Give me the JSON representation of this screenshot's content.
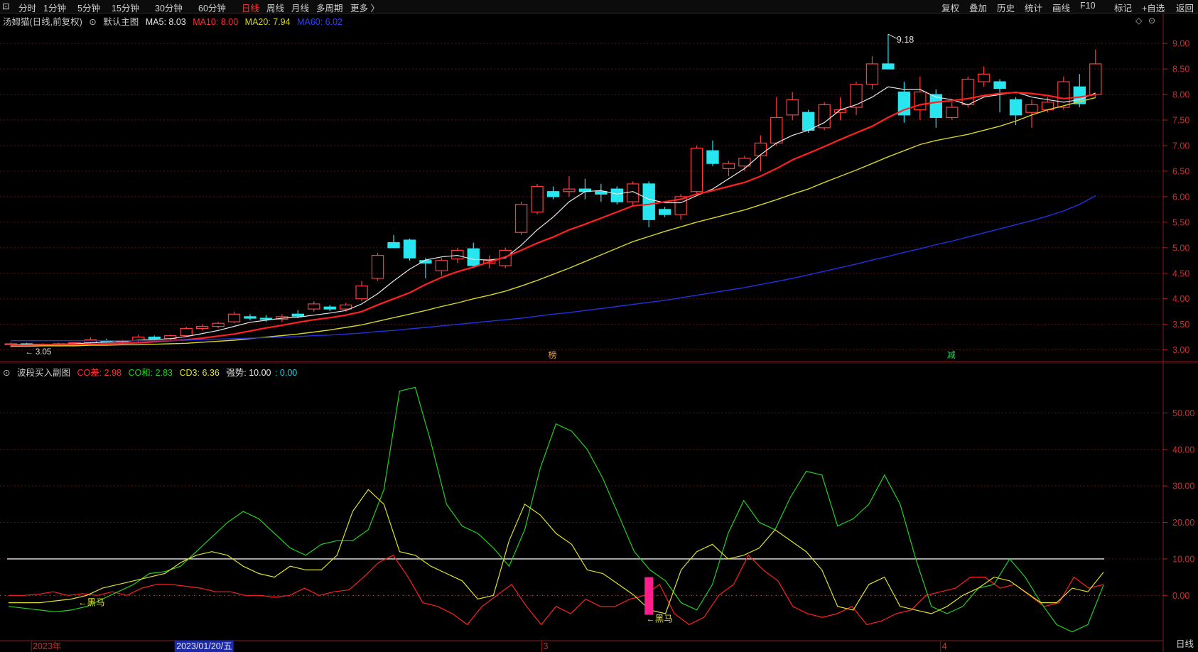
{
  "toolbar": {
    "left": [
      {
        "label": "分时",
        "active": false
      },
      {
        "label": "1分钟",
        "active": false
      },
      {
        "label": "5分钟",
        "active": false
      },
      {
        "label": "15分钟",
        "active": false
      },
      {
        "label": "30分钟",
        "active": false
      },
      {
        "label": "60分钟",
        "active": false
      },
      {
        "label": "日线",
        "active": true
      },
      {
        "label": "周线",
        "active": false
      },
      {
        "label": "月线",
        "active": false
      },
      {
        "label": "多周期",
        "active": false
      },
      {
        "label": "更多 〉",
        "active": false
      }
    ],
    "right": [
      "复权",
      "叠加",
      "历史",
      "统计",
      "画线",
      "F10",
      "标记",
      "+自选",
      "返回"
    ]
  },
  "main_legend": {
    "stock": "汤姆猫(日线,前复权)",
    "template": "默认主图",
    "ma5": "MA5: 8.03",
    "ma10": "MA10: 8.00",
    "ma20": "MA20: 7.94",
    "ma60": "MA60: 6.02"
  },
  "sub_legend": {
    "title": "波段买入副图",
    "co_diff": "CO差: 2.98",
    "co_sum": "CO和: 2.83",
    "cd3": "CD3: 6.36",
    "strength": "强势: 10.00",
    "strength2": ": 0.00"
  },
  "colors": {
    "up": "#ff3b3b",
    "down": "#28e6f0",
    "ma5": "#e8e8e8",
    "ma10": "#ff2020",
    "ma20": "#d6d624",
    "ma60": "#2430e0",
    "co_diff": "#ff2020",
    "co_sum": "#22d022",
    "cd3": "#e0e030",
    "signal": "#ff1e8c"
  },
  "annotations": {
    "high_label": "9.18",
    "low_label": "3.05",
    "mark1": "榜",
    "mark2": "减",
    "heima1": "黑马",
    "heima2": "黑马"
  },
  "x_axis": {
    "labels": [
      {
        "text": "2023年",
        "idx": 2
      },
      {
        "text": "2023/01/20/五",
        "idx": 11
      },
      {
        "text": "3",
        "idx": 34
      },
      {
        "text": "4",
        "idx": 59
      }
    ]
  },
  "bottom_tab": "日线",
  "chart_data": [
    {
      "type": "candlestick",
      "title": "汤姆猫(日线,前复权)",
      "ylim": [
        2.8,
        9.35
      ],
      "yticks": [
        3.0,
        3.5,
        4.0,
        4.5,
        5.0,
        5.5,
        6.0,
        6.5,
        7.0,
        7.5,
        8.0,
        8.5,
        9.0
      ],
      "ohlc": [
        [
          3.1,
          3.15,
          3.05,
          3.12
        ],
        [
          3.12,
          3.14,
          3.08,
          3.1
        ],
        [
          3.1,
          3.13,
          3.07,
          3.11
        ],
        [
          3.11,
          3.14,
          3.09,
          3.12
        ],
        [
          3.12,
          3.15,
          3.1,
          3.14
        ],
        [
          3.14,
          3.25,
          3.12,
          3.2
        ],
        [
          3.18,
          3.22,
          3.14,
          3.16
        ],
        [
          3.16,
          3.2,
          3.12,
          3.18
        ],
        [
          3.18,
          3.3,
          3.15,
          3.25
        ],
        [
          3.25,
          3.28,
          3.2,
          3.22
        ],
        [
          3.22,
          3.3,
          3.18,
          3.28
        ],
        [
          3.28,
          3.45,
          3.25,
          3.42
        ],
        [
          3.42,
          3.5,
          3.38,
          3.46
        ],
        [
          3.46,
          3.55,
          3.42,
          3.52
        ],
        [
          3.55,
          3.75,
          3.52,
          3.7
        ],
        [
          3.65,
          3.7,
          3.58,
          3.62
        ],
        [
          3.62,
          3.68,
          3.55,
          3.6
        ],
        [
          3.6,
          3.7,
          3.55,
          3.65
        ],
        [
          3.7,
          3.78,
          3.62,
          3.66
        ],
        [
          3.8,
          3.95,
          3.75,
          3.9
        ],
        [
          3.84,
          3.88,
          3.76,
          3.8
        ],
        [
          3.8,
          3.92,
          3.75,
          3.88
        ],
        [
          4.0,
          4.35,
          3.95,
          4.25
        ],
        [
          4.4,
          4.9,
          4.35,
          4.85
        ],
        [
          5.1,
          5.25,
          5.0,
          5.0
        ],
        [
          5.15,
          5.18,
          4.75,
          4.8
        ],
        [
          4.75,
          4.8,
          4.4,
          4.7
        ],
        [
          4.55,
          4.8,
          4.45,
          4.75
        ],
        [
          4.78,
          5.0,
          4.7,
          4.95
        ],
        [
          4.98,
          5.1,
          4.6,
          4.65
        ],
        [
          4.7,
          4.85,
          4.6,
          4.75
        ],
        [
          4.65,
          5.0,
          4.6,
          4.95
        ],
        [
          5.3,
          5.9,
          5.25,
          5.85
        ],
        [
          5.7,
          6.25,
          5.65,
          6.2
        ],
        [
          6.1,
          6.2,
          5.95,
          6.0
        ],
        [
          6.1,
          6.4,
          6.0,
          6.15
        ],
        [
          6.15,
          6.35,
          5.95,
          6.1
        ],
        [
          6.1,
          6.25,
          5.9,
          6.05
        ],
        [
          6.15,
          6.2,
          5.85,
          5.9
        ],
        [
          5.9,
          6.3,
          5.8,
          6.25
        ],
        [
          6.25,
          6.3,
          5.4,
          5.55
        ],
        [
          5.75,
          5.8,
          5.6,
          5.65
        ],
        [
          5.65,
          6.05,
          5.55,
          6.0
        ],
        [
          6.1,
          7.0,
          6.05,
          6.95
        ],
        [
          6.9,
          7.1,
          6.6,
          6.65
        ],
        [
          6.55,
          6.7,
          6.4,
          6.65
        ],
        [
          6.6,
          6.8,
          6.5,
          6.75
        ],
        [
          6.8,
          7.2,
          6.5,
          7.05
        ],
        [
          7.05,
          7.95,
          7.0,
          7.55
        ],
        [
          7.6,
          8.05,
          7.5,
          7.9
        ],
        [
          7.65,
          7.7,
          7.25,
          7.3
        ],
        [
          7.35,
          7.85,
          7.3,
          7.8
        ],
        [
          7.65,
          7.95,
          7.5,
          7.7
        ],
        [
          7.75,
          8.25,
          7.6,
          8.2
        ],
        [
          8.2,
          8.75,
          8.1,
          8.6
        ],
        [
          8.6,
          9.18,
          8.5,
          8.5
        ],
        [
          8.05,
          8.25,
          7.45,
          7.6
        ],
        [
          7.7,
          8.35,
          7.5,
          8.05
        ],
        [
          8.0,
          8.1,
          7.35,
          7.55
        ],
        [
          7.55,
          7.85,
          7.5,
          7.75
        ],
        [
          7.8,
          8.35,
          7.75,
          8.3
        ],
        [
          8.25,
          8.55,
          8.15,
          8.4
        ],
        [
          8.25,
          8.3,
          7.65,
          8.12
        ],
        [
          7.9,
          7.95,
          7.4,
          7.6
        ],
        [
          7.65,
          7.9,
          7.35,
          7.8
        ],
        [
          7.7,
          7.95,
          7.65,
          7.85
        ],
        [
          7.75,
          8.35,
          7.7,
          8.25
        ],
        [
          8.15,
          8.4,
          7.75,
          7.82
        ],
        [
          8.0,
          8.88,
          7.95,
          8.6
        ]
      ],
      "series": [
        {
          "name": "MA5",
          "values": [
            3.1,
            3.11,
            3.11,
            3.11,
            3.12,
            3.14,
            3.15,
            3.16,
            3.19,
            3.2,
            3.22,
            3.26,
            3.32,
            3.38,
            3.46,
            3.54,
            3.58,
            3.62,
            3.64,
            3.68,
            3.72,
            3.77,
            3.9,
            4.1,
            4.35,
            4.58,
            4.76,
            4.82,
            4.85,
            4.77,
            4.76,
            4.8,
            5.05,
            5.35,
            5.6,
            5.9,
            6.1,
            6.12,
            6.05,
            6.1,
            5.95,
            5.88,
            5.88,
            6.02,
            6.15,
            6.35,
            6.55,
            6.82,
            7.05,
            7.2,
            7.3,
            7.45,
            7.7,
            7.8,
            7.95,
            8.15,
            8.1,
            8.1,
            7.95,
            7.9,
            7.8,
            7.95,
            8.0,
            8.05,
            7.95,
            7.9,
            7.85,
            7.9,
            8.03
          ]
        },
        {
          "name": "MA10",
          "values": [
            3.09,
            3.09,
            3.1,
            3.1,
            3.1,
            3.11,
            3.12,
            3.13,
            3.14,
            3.16,
            3.18,
            3.2,
            3.23,
            3.27,
            3.31,
            3.37,
            3.43,
            3.48,
            3.54,
            3.59,
            3.63,
            3.68,
            3.75,
            3.88,
            4.0,
            4.12,
            4.28,
            4.42,
            4.53,
            4.62,
            4.72,
            4.82,
            4.95,
            5.09,
            5.21,
            5.35,
            5.46,
            5.58,
            5.7,
            5.82,
            5.85,
            5.9,
            5.95,
            6.05,
            6.12,
            6.2,
            6.28,
            6.4,
            6.55,
            6.72,
            6.85,
            6.98,
            7.12,
            7.25,
            7.38,
            7.55,
            7.7,
            7.8,
            7.85,
            7.88,
            7.92,
            7.98,
            8.02,
            8.04,
            8.02,
            7.98,
            7.92,
            7.95,
            8.0
          ]
        },
        {
          "name": "MA20",
          "values": [
            3.07,
            3.07,
            3.08,
            3.08,
            3.08,
            3.09,
            3.09,
            3.1,
            3.1,
            3.11,
            3.12,
            3.13,
            3.15,
            3.17,
            3.19,
            3.22,
            3.25,
            3.28,
            3.31,
            3.35,
            3.39,
            3.44,
            3.49,
            3.56,
            3.63,
            3.7,
            3.77,
            3.85,
            3.92,
            4.0,
            4.07,
            4.15,
            4.25,
            4.36,
            4.48,
            4.6,
            4.73,
            4.86,
            4.99,
            5.12,
            5.22,
            5.32,
            5.41,
            5.5,
            5.58,
            5.66,
            5.74,
            5.84,
            5.94,
            6.05,
            6.15,
            6.28,
            6.4,
            6.52,
            6.65,
            6.78,
            6.9,
            7.02,
            7.1,
            7.16,
            7.22,
            7.3,
            7.38,
            7.48,
            7.6,
            7.7,
            7.78,
            7.86,
            7.94
          ]
        },
        {
          "name": "MA60",
          "values": [
            3.18,
            3.18,
            3.18,
            3.18,
            3.18,
            3.18,
            3.18,
            3.18,
            3.18,
            3.18,
            3.18,
            3.19,
            3.2,
            3.21,
            3.22,
            3.23,
            3.24,
            3.25,
            3.26,
            3.28,
            3.29,
            3.31,
            3.33,
            3.36,
            3.38,
            3.41,
            3.44,
            3.47,
            3.5,
            3.53,
            3.56,
            3.59,
            3.62,
            3.66,
            3.7,
            3.73,
            3.77,
            3.81,
            3.85,
            3.89,
            3.93,
            3.97,
            4.02,
            4.07,
            4.12,
            4.17,
            4.22,
            4.28,
            4.34,
            4.4,
            4.47,
            4.54,
            4.61,
            4.68,
            4.76,
            4.83,
            4.91,
            4.98,
            5.06,
            5.13,
            5.21,
            5.29,
            5.37,
            5.45,
            5.53,
            5.62,
            5.72,
            5.85,
            6.02
          ]
        }
      ]
    },
    {
      "type": "line",
      "title": "波段买入副图",
      "ylim": [
        -12,
        60
      ],
      "yticks": [
        0,
        10,
        20,
        30,
        40,
        50
      ],
      "ytick_labels": [
        "0.00",
        "10.00",
        "20.00",
        "30.00",
        "40.00",
        "50.00"
      ],
      "hline": 10,
      "series": [
        {
          "name": "CO差",
          "values": [
            0,
            0,
            0.3,
            1,
            0,
            0.5,
            0,
            1,
            0,
            2,
            3,
            3,
            2.5,
            2,
            1,
            1,
            0,
            0,
            -0.5,
            0,
            2,
            0,
            1,
            1.5,
            5,
            9,
            11,
            5,
            -2,
            -3,
            -5,
            -8,
            -3,
            0,
            3,
            -3,
            -8,
            -3,
            -5,
            -1,
            -3,
            -3,
            -1,
            0,
            3,
            -5,
            -8,
            -6,
            0,
            3,
            11,
            7,
            4,
            -3,
            -5,
            -6,
            -5,
            -3,
            -8,
            -7,
            -5,
            -4,
            0,
            1,
            2,
            5,
            5,
            2,
            3,
            0,
            -3,
            -2,
            5,
            2,
            2.98
          ]
        },
        {
          "name": "CO和",
          "values": [
            -3,
            -3.5,
            -4,
            -4.5,
            -4,
            -3,
            -1,
            1,
            3,
            6,
            6.5,
            8,
            12,
            16,
            20,
            23,
            21,
            17,
            13,
            11,
            14,
            15,
            15,
            18,
            29,
            56,
            57,
            42,
            25,
            19,
            17,
            13,
            8,
            18,
            35,
            47,
            45,
            40,
            32,
            22,
            12,
            7,
            4,
            -2,
            -4,
            3,
            17,
            26,
            20,
            18,
            27,
            34,
            33,
            19,
            21,
            25,
            33,
            25,
            10,
            -3,
            -5,
            -3,
            2,
            3,
            10,
            5,
            -2,
            -8,
            -10,
            -8,
            2.83
          ]
        },
        {
          "name": "CD3",
          "values": [
            -2,
            -2,
            -2,
            -1.5,
            -1,
            0,
            2,
            3,
            4,
            5,
            6,
            9,
            11,
            12,
            11,
            8,
            6,
            5,
            8,
            7,
            7,
            11,
            23,
            29,
            25,
            12,
            11,
            8,
            6,
            4,
            -1,
            0,
            15,
            25,
            22,
            17,
            14,
            7,
            6,
            3,
            0,
            -4,
            -5,
            7,
            12,
            14,
            10,
            11,
            13,
            18,
            15,
            12,
            7,
            -3,
            -4,
            3,
            5,
            -3,
            -4,
            -5,
            -3,
            0,
            2,
            5,
            4,
            1,
            -2,
            -2,
            2,
            1,
            6.36
          ]
        },
        {
          "name": "强势",
          "values": [
            10
          ]
        }
      ]
    }
  ]
}
